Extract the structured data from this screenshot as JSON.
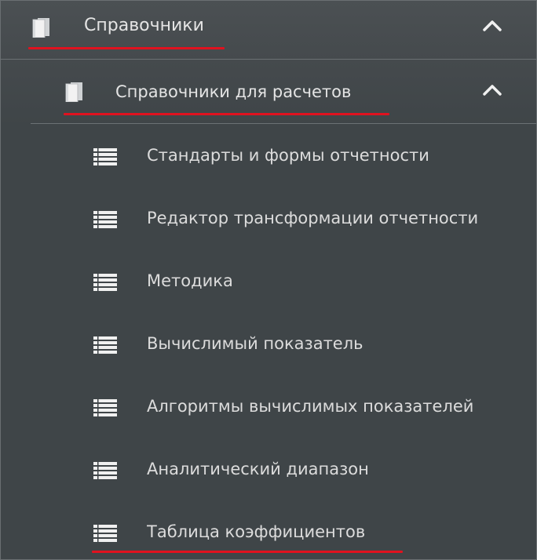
{
  "tree": {
    "section": {
      "label": "Справочники",
      "icon": "book-icon",
      "expand_icon": "chevron-up-icon"
    },
    "subsection": {
      "label": "Справочники для расчетов",
      "icon": "book-icon",
      "expand_icon": "chevron-up-icon"
    },
    "items": [
      {
        "label": "Стандарты и формы отчетности",
        "icon": "list-icon"
      },
      {
        "label": "Редактор трансформации отчетности",
        "icon": "list-icon"
      },
      {
        "label": "Методика",
        "icon": "list-icon"
      },
      {
        "label": "Вычислимый показатель",
        "icon": "list-icon"
      },
      {
        "label": "Алгоритмы вычислимых показателей",
        "icon": "list-icon"
      },
      {
        "label": "Аналитический диапазон",
        "icon": "list-icon"
      },
      {
        "label": "Таблица коэффициентов",
        "icon": "list-icon"
      }
    ]
  },
  "colors": {
    "background": "#3f4548",
    "text": "#dcdcdc",
    "highlight_underline": "#e0121f"
  }
}
